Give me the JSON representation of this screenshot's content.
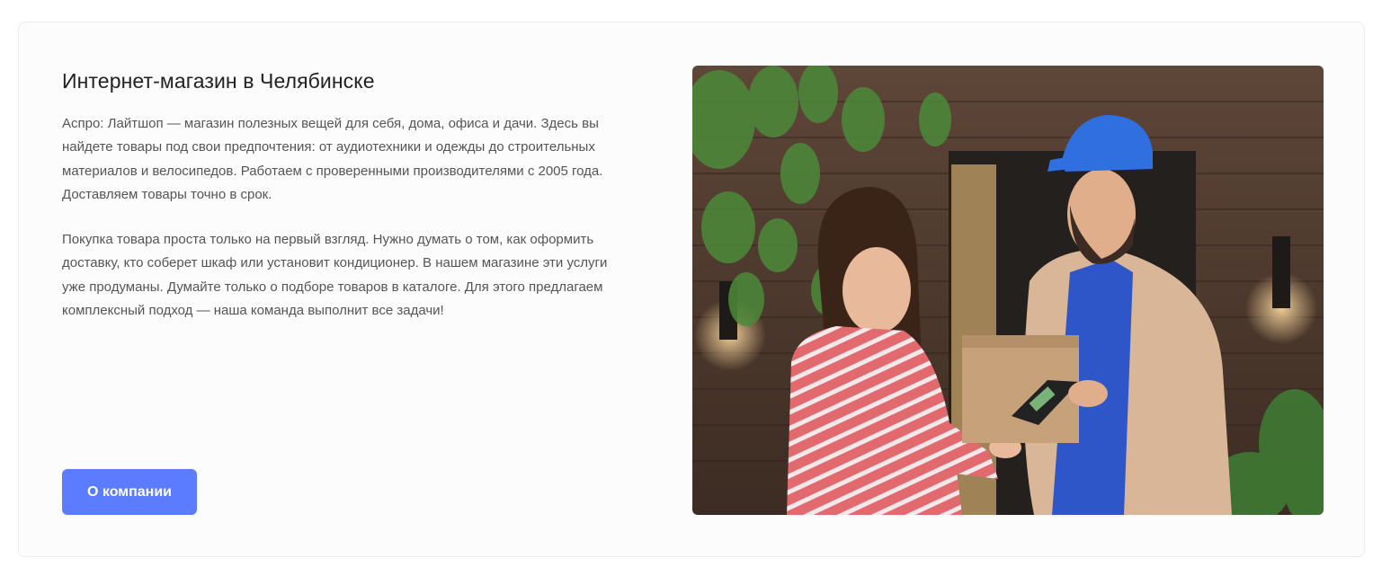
{
  "about": {
    "title": "Интернет-магазин в Челябинске",
    "paragraph_1": "Аспро: Лайтшоп — магазин полезных вещей для себя, дома, офиса и дачи. Здесь вы найдете товары под свои предпочтения: от аудиотехники и одежды до строительных материалов и велосипедов. Работаем с проверенными производителями с 2005 года. Доставляем товары точно в срок.",
    "paragraph_2": "Покупка товара проста только на первый взгляд. Нужно думать о том, как оформить доставку, кто соберет шкаф или установит кондиционер. В нашем магазине эти услуги уже продуманы. Думайте только о подборе товаров в каталоге. Для этого предлагаем комплексный подход — наша команда выполнит все задачи!",
    "button_label": "О компании"
  },
  "colors": {
    "accent": "#5b7cff",
    "title_text": "#222222",
    "body_text": "#555555",
    "card_border": "#ececec"
  }
}
